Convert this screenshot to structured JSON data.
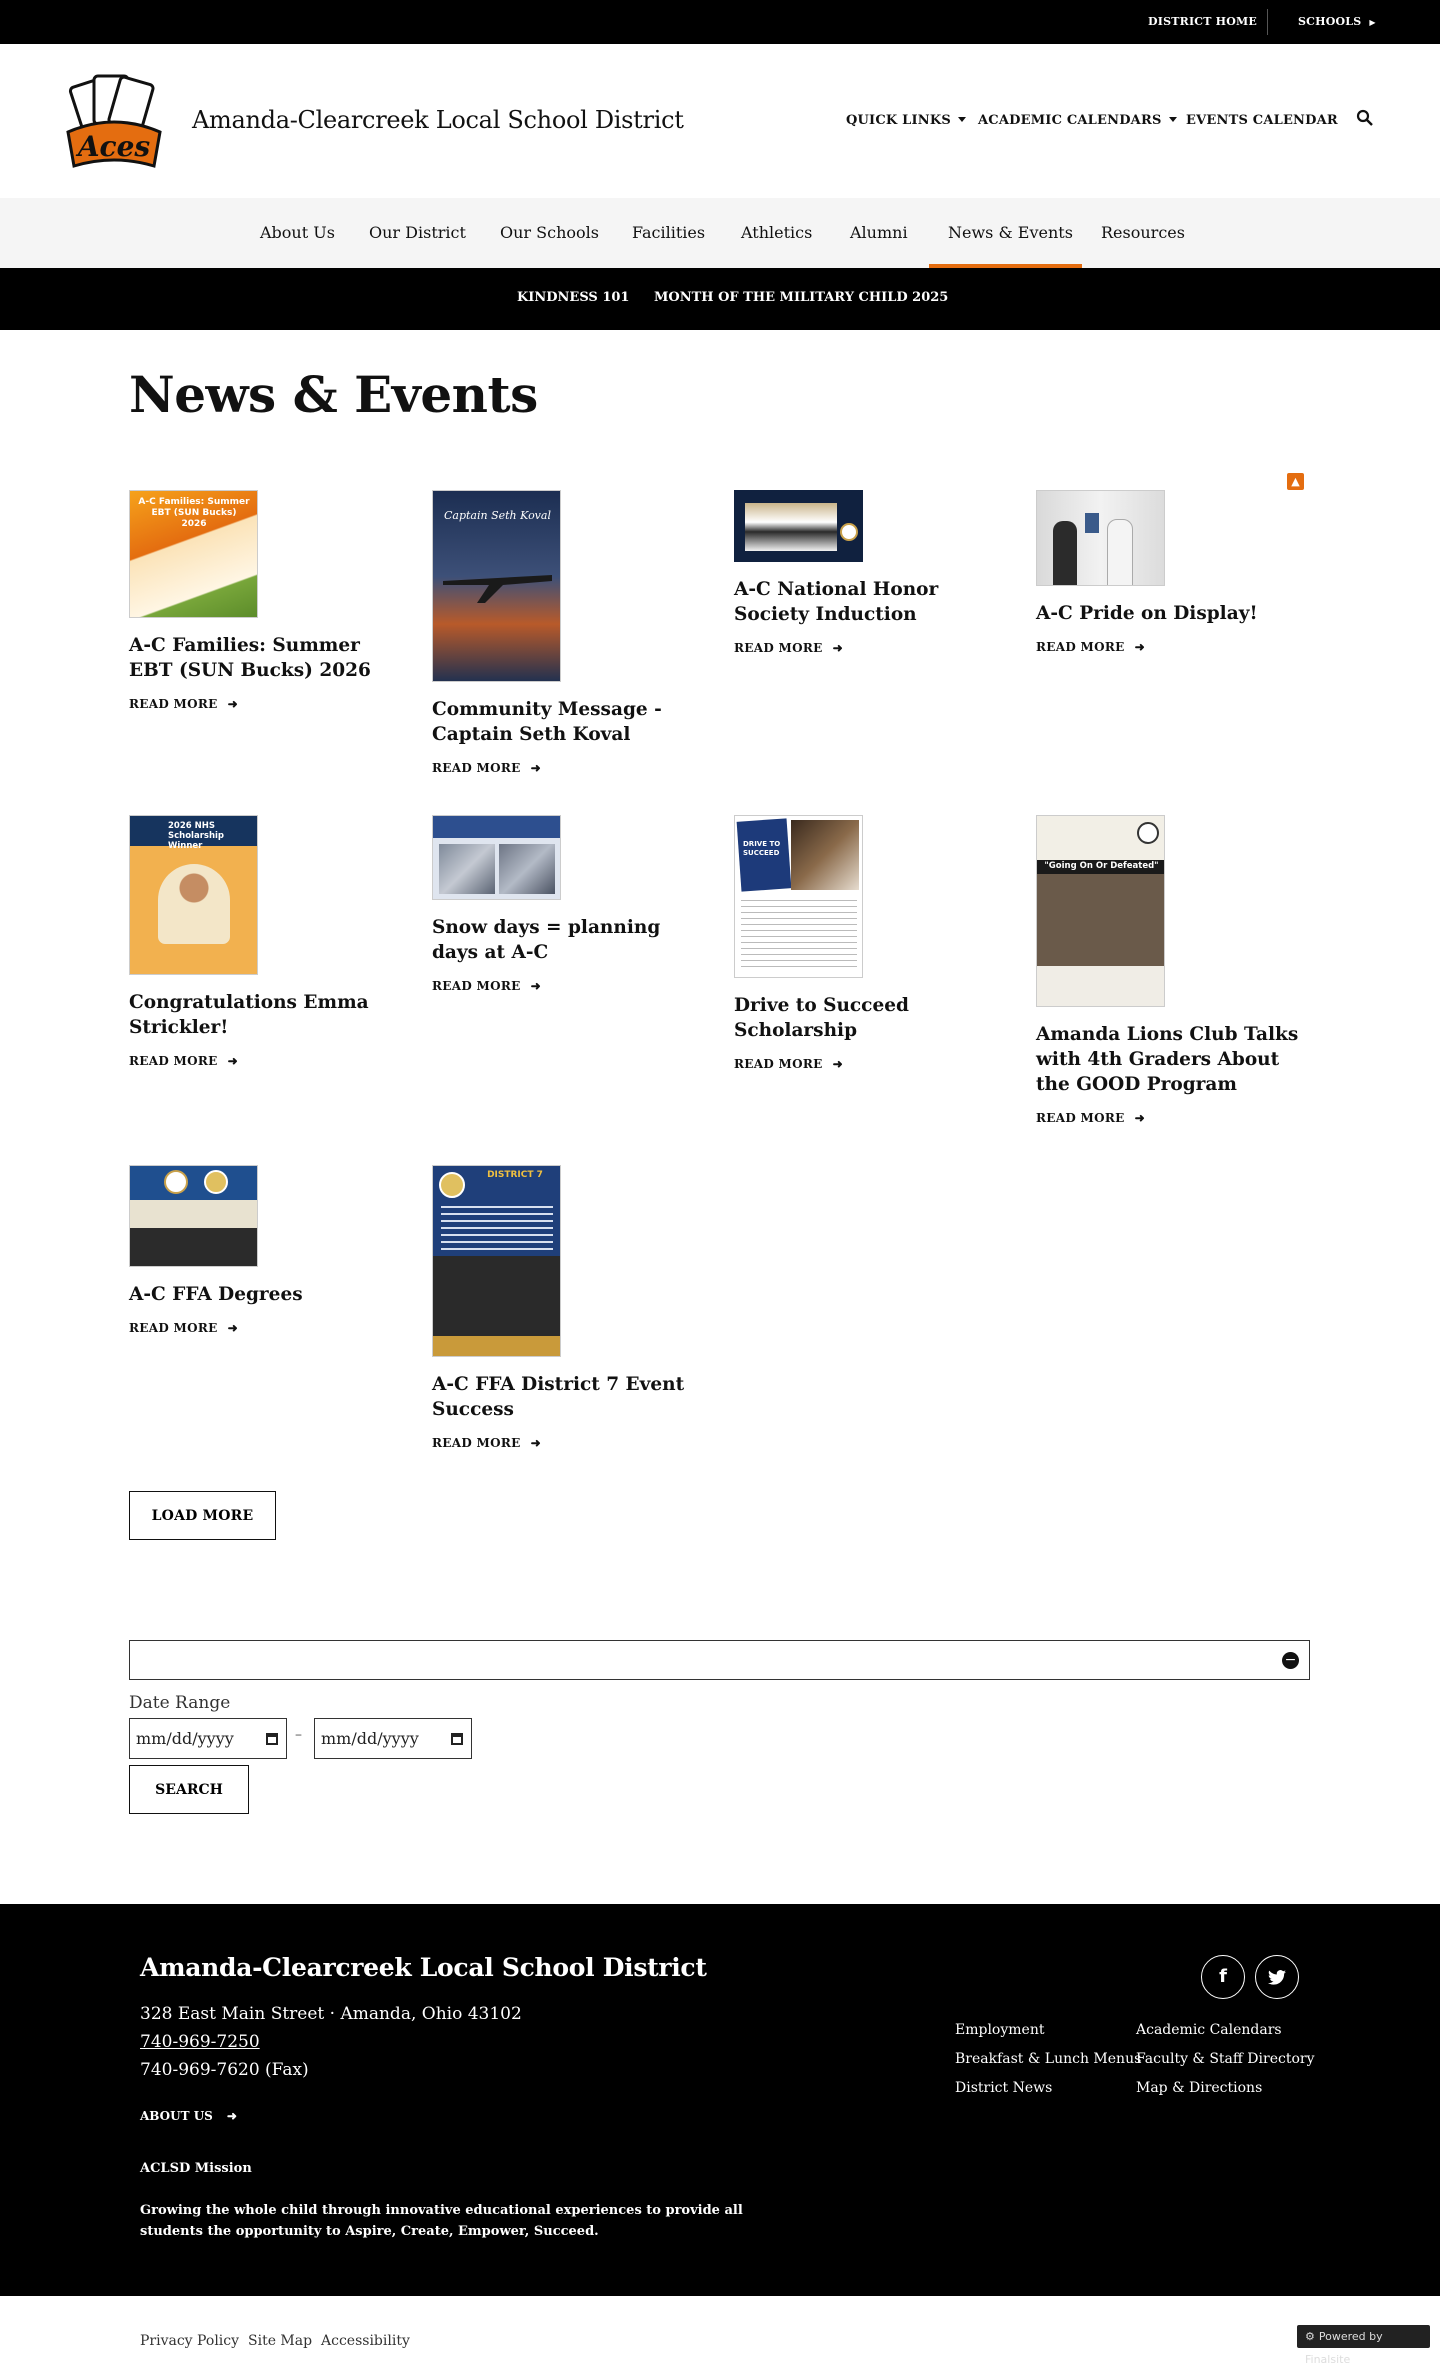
{
  "topbar": {
    "district_home": "DISTRICT HOME",
    "schools": "SCHOOLS"
  },
  "header": {
    "logo_text": "Aces",
    "title": "Amanda-Clearcreek Local School District",
    "quick_links": "QUICK LINKS",
    "academic_calendars": "ACADEMIC CALENDARS",
    "events_calendar": "EVENTS CALENDAR"
  },
  "nav": {
    "items": [
      "About Us",
      "Our District",
      "Our Schools",
      "Facilities",
      "Athletics",
      "Alumni",
      "News & Events",
      "Resources"
    ],
    "active": "News & Events"
  },
  "subnav": {
    "items": [
      "KINDNESS 101",
      "MONTH OF THE MILITARY CHILD 2025"
    ]
  },
  "page": {
    "title": "News & Events"
  },
  "articles": [
    {
      "title": "A-C Families: Summer EBT (SUN Bucks) 2026",
      "read_more": "READ MORE",
      "thumb_text": "A-C Families: Summer EBT (SUN Bucks) 2026"
    },
    {
      "title": "Community Message - Captain Seth Koval",
      "read_more": "READ MORE",
      "thumb_text": "Captain Seth Koval"
    },
    {
      "title": "A-C National Honor Society Induction",
      "read_more": "READ MORE",
      "thumb_text": ""
    },
    {
      "title": "A-C Pride on Display!",
      "read_more": "READ MORE",
      "thumb_text": ""
    },
    {
      "title": "Congratulations Emma Strickler!",
      "read_more": "READ MORE",
      "thumb_text": "2026 NHS Scholarship Winner"
    },
    {
      "title": "Snow days = planning days at A-C",
      "read_more": "READ MORE",
      "thumb_text": ""
    },
    {
      "title": "Drive to Succeed Scholarship",
      "read_more": "READ MORE",
      "thumb_text": "DRIVE TO SUCCEED"
    },
    {
      "title": "Amanda Lions Club Talks with 4th Graders About the GOOD Program",
      "read_more": "READ MORE",
      "thumb_text": "\"Going On Or Defeated\""
    },
    {
      "title": "A-C FFA Degrees",
      "read_more": "READ MORE",
      "thumb_text": ""
    },
    {
      "title": "A-C FFA District 7 Event Success",
      "read_more": "READ MORE",
      "thumb_text": "DISTRICT 7"
    }
  ],
  "load_more": "LOAD MORE",
  "filter": {
    "date_range_label": "Date Range",
    "start_placeholder": "mm/dd/yyyy",
    "end_placeholder": "mm/dd/yyyy",
    "search": "SEARCH"
  },
  "footer": {
    "title": "Amanda-Clearcreek Local School District",
    "address": "328 East Main Street · Amanda, Ohio  43102",
    "phone": "740-969-7250",
    "fax": "740-969-7620 (Fax)",
    "about_us": "ABOUT US",
    "mission_heading": "ACLSD Mission",
    "mission": "Growing the whole child through innovative educational experiences to provide all students the opportunity to Aspire, Create, Empower, Succeed.",
    "links": [
      "Employment",
      "Academic Calendars",
      "Breakfast & Lunch Menus",
      "Faculty & Staff Directory",
      "District News",
      "Map & Directions"
    ],
    "social": [
      "facebook",
      "twitter"
    ]
  },
  "bottom": {
    "links": [
      "Privacy Policy",
      "Site Map",
      "Accessibility"
    ],
    "powered_by": "Powered by Finalsite"
  },
  "colors": {
    "accent": "#e46d10",
    "dark": "#000000"
  }
}
